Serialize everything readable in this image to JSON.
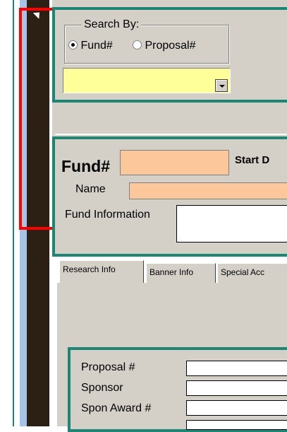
{
  "search": {
    "group_label": "Search By:",
    "options": [
      {
        "label": "Fund#",
        "selected": true
      },
      {
        "label": "Proposal#",
        "selected": false
      }
    ],
    "dropdown_value": ""
  },
  "fund": {
    "fund_label": "Fund#",
    "start_date_label": "Start D",
    "name_label": "Name",
    "fund_info_label": "Fund Information"
  },
  "tabs": [
    {
      "label": "Research Info",
      "active": true
    },
    {
      "label": "Banner Info",
      "active": false
    },
    {
      "label": "Special Acc",
      "active": false
    }
  ],
  "research": {
    "proposal_label": "Proposal #",
    "sponsor_label": "Sponsor",
    "spon_award_label": "Spon Award #"
  },
  "colors": {
    "panel": "#d4d0c8",
    "teal_border": "#1e8474",
    "highlight_field": "#ffff99",
    "peach_field": "#fcc89b",
    "left_bar": "#2c1f14",
    "selection_outline": "#ff0000"
  }
}
